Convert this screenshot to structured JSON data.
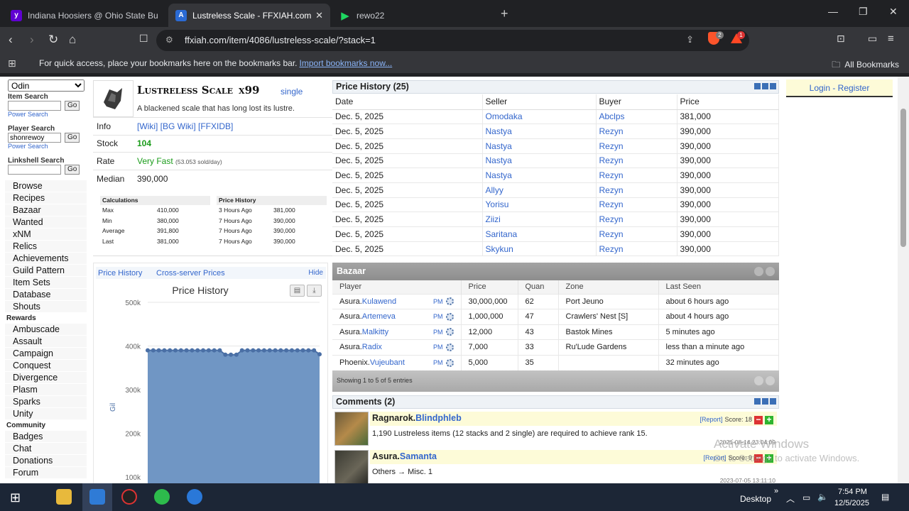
{
  "browser": {
    "tabs": [
      {
        "title": "Indiana Hoosiers @ Ohio State Buck",
        "icon": "yahoo-icon",
        "color": "#6001d2"
      },
      {
        "title": "Lustreless Scale - FFXIAH.com",
        "icon": "ffxiah-icon",
        "color": "#2a6ad4"
      },
      {
        "title": "rewo22",
        "icon": "play-icon",
        "color": "#1ed760"
      }
    ],
    "url": "ffxiah.com/item/4086/lustreless-scale/?stack=1",
    "brave_badge": "2",
    "rewards_badge": "1",
    "bookmarks_msg": "For quick access, place your bookmarks here on the bookmarks bar.",
    "bookmarks_import": "Import bookmarks now...",
    "all_bookmarks": "All Bookmarks"
  },
  "leftnav": {
    "server": "Odin",
    "item_search": "Item Search",
    "go": "Go",
    "power_search": "Power Search",
    "player_search": "Player Search",
    "player_value": "shonrewoy",
    "linkshell_search": "Linkshell Search",
    "main_items": [
      "Browse",
      "Recipes",
      "Bazaar",
      "Wanted",
      "xNM",
      "Relics",
      "Achievements",
      "Guild Pattern",
      "Item Sets",
      "Database",
      "Shouts"
    ],
    "rewards_title": "Rewards",
    "rewards_items": [
      "Ambuscade",
      "Assault",
      "Campaign",
      "Conquest",
      "Divergence",
      "Plasm",
      "Sparks",
      "Unity"
    ],
    "community_title": "Community",
    "community_items": [
      "Badges",
      "Chat",
      "Donations",
      "Forum"
    ]
  },
  "item": {
    "name": "Lustreless Scale",
    "qty": "x99",
    "single": "single",
    "desc": "A blackened scale that has long lost its lustre.",
    "info_label": "Info",
    "links": [
      "[Wiki]",
      "[BG Wiki]",
      "[FFXIDB]"
    ],
    "stock_label": "Stock",
    "stock": "104",
    "rate_label": "Rate",
    "rate": "Very Fast",
    "rate_detail": "(53.053 sold/day)",
    "median_label": "Median",
    "median": "390,000"
  },
  "calculations": {
    "title": "Calculations",
    "rows": [
      [
        "Max",
        "410,000"
      ],
      [
        "Min",
        "380,000"
      ],
      [
        "Average",
        "391,800"
      ],
      [
        "Last",
        "381,000"
      ]
    ]
  },
  "mini_history": {
    "title": "Price History",
    "rows": [
      [
        "3 Hours Ago",
        "381,000"
      ],
      [
        "7 Hours Ago",
        "390,000"
      ],
      [
        "7 Hours Ago",
        "390,000"
      ],
      [
        "7 Hours Ago",
        "390,000"
      ]
    ]
  },
  "chart_panel": {
    "tab_history": "Price History",
    "tab_cross": "Cross-server Prices",
    "hide": "Hide"
  },
  "chart_data": {
    "type": "area",
    "title": "Price History",
    "ylabel": "Gil",
    "ylim": [
      100000,
      500000
    ],
    "yticks": [
      "500k",
      "400k",
      "300k",
      "200k",
      "100k"
    ],
    "values": [
      390000,
      390000,
      390000,
      390000,
      390000,
      390000,
      390000,
      390000,
      390000,
      390000,
      390000,
      390000,
      390000,
      390000,
      380000,
      380000,
      380000,
      390000,
      390000,
      390000,
      390000,
      390000,
      390000,
      390000,
      390000,
      390000,
      390000,
      390000,
      390000,
      390000,
      390000,
      381000
    ]
  },
  "price_history": {
    "title": "Price History (25)",
    "headers": [
      "Date",
      "Seller",
      "Buyer",
      "Price"
    ],
    "rows": [
      [
        "Dec. 5, 2025",
        "Omodaka",
        "Abclps",
        "381,000"
      ],
      [
        "Dec. 5, 2025",
        "Nastya",
        "Rezyn",
        "390,000"
      ],
      [
        "Dec. 5, 2025",
        "Nastya",
        "Rezyn",
        "390,000"
      ],
      [
        "Dec. 5, 2025",
        "Nastya",
        "Rezyn",
        "390,000"
      ],
      [
        "Dec. 5, 2025",
        "Nastya",
        "Rezyn",
        "390,000"
      ],
      [
        "Dec. 5, 2025",
        "Allyy",
        "Rezyn",
        "390,000"
      ],
      [
        "Dec. 5, 2025",
        "Yorisu",
        "Rezyn",
        "390,000"
      ],
      [
        "Dec. 5, 2025",
        "Ziizi",
        "Rezyn",
        "390,000"
      ],
      [
        "Dec. 5, 2025",
        "Saritana",
        "Rezyn",
        "390,000"
      ],
      [
        "Dec. 5, 2025",
        "Skykun",
        "Rezyn",
        "390,000"
      ]
    ]
  },
  "bazaar": {
    "title": "Bazaar",
    "headers": [
      "Player",
      "Price",
      "Quan",
      "Zone",
      "Last Seen"
    ],
    "pm": "PM",
    "rows": [
      {
        "server": "Asura.",
        "name": "Kulawend",
        "price": "30,000,000",
        "quan": "62",
        "zone": "Port Jeuno",
        "seen": "about 6 hours ago"
      },
      {
        "server": "Asura.",
        "name": "Artemeva",
        "price": "1,000,000",
        "quan": "47",
        "zone": "Crawlers' Nest [S]",
        "seen": "about 4 hours ago"
      },
      {
        "server": "Asura.",
        "name": "Malkitty",
        "price": "12,000",
        "quan": "43",
        "zone": "Bastok Mines",
        "seen": "5 minutes ago"
      },
      {
        "server": "Asura.",
        "name": "Radix",
        "price": "7,000",
        "quan": "33",
        "zone": "Ru'Lude Gardens",
        "seen": "less than a minute ago"
      },
      {
        "server": "Phoenix.",
        "name": "Vujeubant",
        "price": "5,000",
        "quan": "35",
        "zone": "",
        "seen": "32 minutes ago"
      }
    ],
    "footer": "Showing 1 to 5 of 5 entries"
  },
  "comments": {
    "title": "Comments (2)",
    "report": "[Report]",
    "items": [
      {
        "server": "Ragnarok.",
        "user": "Blindphleb",
        "score": "Score: 18",
        "text": "1,190 Lustreless items (12 stacks and 2 single) are required to achieve rank 15.",
        "date": "2021-08-14 23:04:09"
      },
      {
        "server": "Asura.",
        "user": "Samanta",
        "score": "Score: 9",
        "text": "Others → Misc. 1",
        "date": "2023-07-05 13:11:10"
      }
    ]
  },
  "right": {
    "login": "Login - Register"
  },
  "watermark": {
    "line1": "Activate Windows",
    "line2": "Go to Settings to activate Windows."
  },
  "taskbar": {
    "desktop": "Desktop",
    "time": "7:54 PM",
    "date": "12/5/2025"
  }
}
